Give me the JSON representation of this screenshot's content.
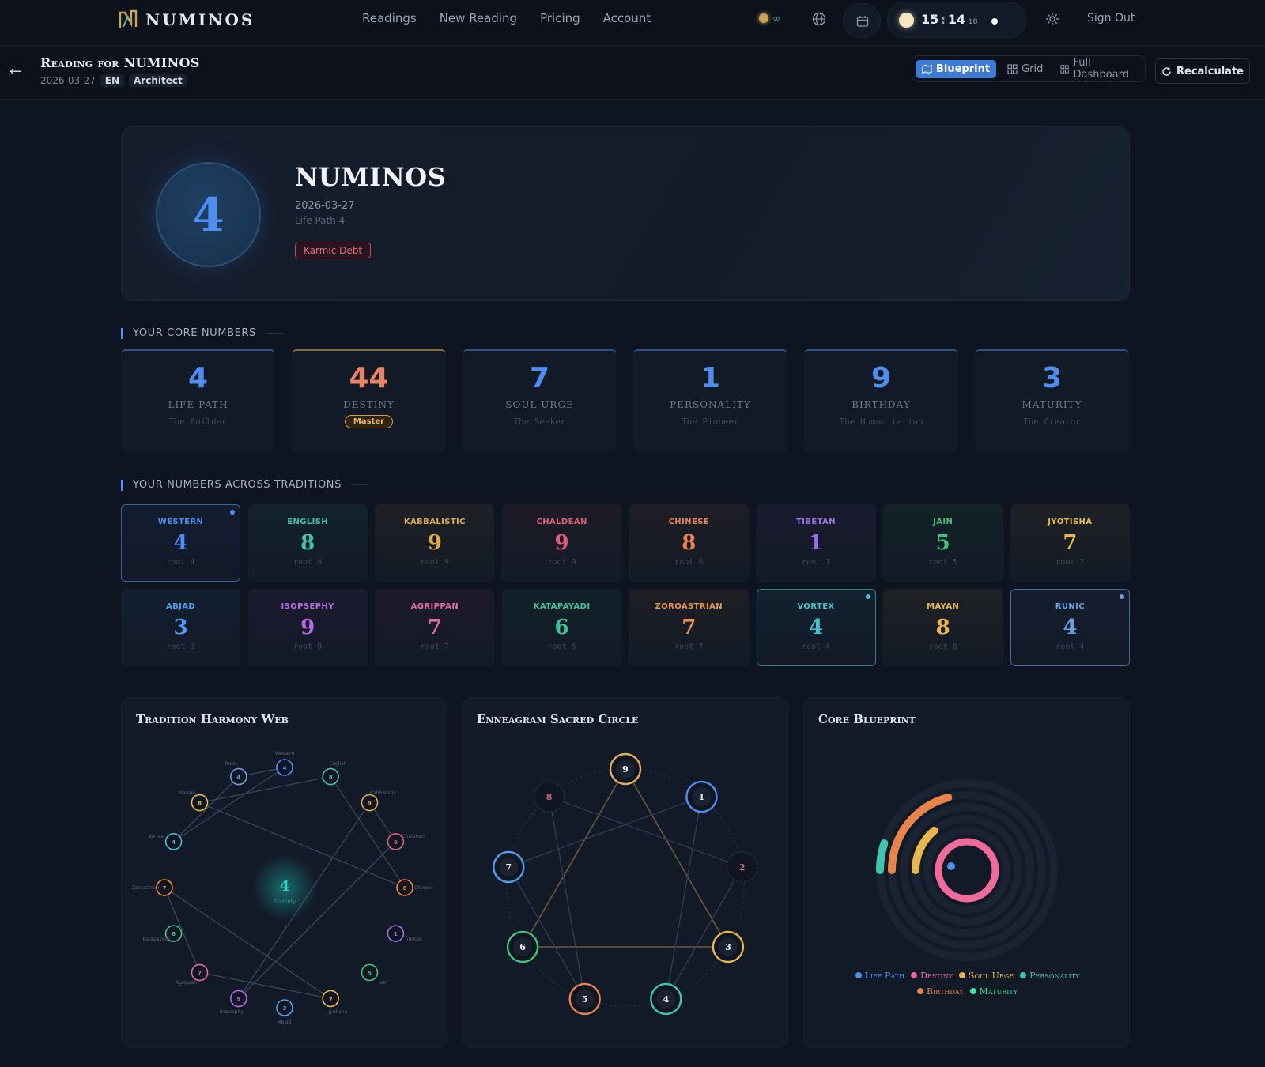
{
  "app": {
    "name": "NUMINOS"
  },
  "nav": {
    "items": [
      "Readings",
      "New Reading",
      "Pricing",
      "Account"
    ],
    "credits": "∞",
    "time_h": "15",
    "time_m": "14",
    "time_s": "18",
    "signout": "Sign Out"
  },
  "reading": {
    "title": "Reading for NUMINOS",
    "date": "2026-03-27",
    "lang": "EN",
    "mode": "Architect"
  },
  "views": {
    "items": [
      "Blueprint",
      "Grid",
      "Full Dashboard"
    ],
    "active": "Blueprint",
    "recalc": "Recalculate"
  },
  "hero": {
    "number": "4",
    "name": "NUMINOS",
    "date": "2026-03-27",
    "lifepath": "Life Path 4",
    "badge": "Karmic Debt"
  },
  "core": {
    "title": "YOUR CORE NUMBERS",
    "cards": [
      {
        "num": "4",
        "label": "LIFE PATH",
        "sub": "The Builder",
        "color": "#4d8ff0"
      },
      {
        "num": "44",
        "label": "DESTINY",
        "sub": "",
        "badge": "Master",
        "color": "#e8836a"
      },
      {
        "num": "7",
        "label": "SOUL URGE",
        "sub": "The Seeker",
        "color": "#4d8ff0"
      },
      {
        "num": "1",
        "label": "PERSONALITY",
        "sub": "The Pioneer",
        "color": "#4d8ff0"
      },
      {
        "num": "9",
        "label": "BIRTHDAY",
        "sub": "The Humanitarian",
        "color": "#4d8ff0"
      },
      {
        "num": "3",
        "label": "MATURITY",
        "sub": "The Creator",
        "color": "#4d8ff0"
      }
    ]
  },
  "traditions": {
    "title": "YOUR NUMBERS ACROSS TRADITIONS",
    "cards": [
      {
        "name": "WESTERN",
        "num": "4",
        "root": "root 4",
        "color": "#4d8ff0",
        "hl": true
      },
      {
        "name": "ENGLISH",
        "num": "8",
        "root": "root 8",
        "color": "#3fc4b0",
        "hl": false
      },
      {
        "name": "KABBALISTIC",
        "num": "9",
        "root": "root 9",
        "color": "#e0a94c",
        "hl": false
      },
      {
        "name": "CHALDEAN",
        "num": "9",
        "root": "root 9",
        "color": "#e25c7a",
        "hl": false
      },
      {
        "name": "CHINESE",
        "num": "8",
        "root": "root 8",
        "color": "#e8834a",
        "hl": false
      },
      {
        "name": "TIBETAN",
        "num": "1",
        "root": "root 1",
        "color": "#9b72e0",
        "hl": false
      },
      {
        "name": "JAIN",
        "num": "5",
        "root": "root 5",
        "color": "#3fc47a",
        "hl": false
      },
      {
        "name": "JYOTISHA",
        "num": "7",
        "root": "root 7",
        "color": "#e8b84a",
        "hl": false
      },
      {
        "name": "ABJAD",
        "num": "3",
        "root": "root 3",
        "color": "#4d9ff0",
        "hl": false
      },
      {
        "name": "ISOPSEPHY",
        "num": "9",
        "root": "root 9",
        "color": "#b46ae0",
        "hl": false
      },
      {
        "name": "AGRIPPAN",
        "num": "7",
        "root": "root 7",
        "color": "#e06aa8",
        "hl": false
      },
      {
        "name": "KATAPAYADI",
        "num": "6",
        "root": "root 6",
        "color": "#3fc49a",
        "hl": false
      },
      {
        "name": "ZOROASTRIAN",
        "num": "7",
        "root": "root 7",
        "color": "#e8944a",
        "hl": false
      },
      {
        "name": "VORTEX",
        "num": "4",
        "root": "root 4",
        "color": "#3fc4d0",
        "hl": true
      },
      {
        "name": "MAYAN",
        "num": "8",
        "root": "root 8",
        "color": "#e8b84a",
        "hl": false
      },
      {
        "name": "RUNIC",
        "num": "4",
        "root": "root 4",
        "color": "#6a9fe0",
        "hl": true
      }
    ]
  },
  "harmony": {
    "title": "Tradition Harmony Web",
    "center": "4",
    "center_label": "Stability",
    "nodes": [
      {
        "label": "Western",
        "num": "4",
        "color": "#4d8ff0"
      },
      {
        "label": "English",
        "num": "8",
        "color": "#3fc4b0"
      },
      {
        "label": "Kabbalistic",
        "num": "9",
        "color": "#e0a94c"
      },
      {
        "label": "Chaldean",
        "num": "9",
        "color": "#e25c7a"
      },
      {
        "label": "Chinese",
        "num": "8",
        "color": "#e8834a"
      },
      {
        "label": "Tibetan",
        "num": "1",
        "color": "#9b72e0"
      },
      {
        "label": "Jain",
        "num": "5",
        "color": "#3fc47a"
      },
      {
        "label": "Jyotisha",
        "num": "7",
        "color": "#e8b84a"
      },
      {
        "label": "Abjad",
        "num": "3",
        "color": "#4d9ff0"
      },
      {
        "label": "Isopsephy",
        "num": "9",
        "color": "#b46ae0"
      },
      {
        "label": "Agrippan",
        "num": "7",
        "color": "#e06aa8"
      },
      {
        "label": "Katapayadi",
        "num": "6",
        "color": "#3fc49a"
      },
      {
        "label": "Zoroastrian",
        "num": "7",
        "color": "#e8944a"
      },
      {
        "label": "Vortex",
        "num": "4",
        "color": "#3fc4d0"
      },
      {
        "label": "Mayan",
        "num": "8",
        "color": "#e8b84a"
      },
      {
        "label": "Runic",
        "num": "4",
        "color": "#6a9fe0"
      }
    ]
  },
  "enneagram": {
    "title": "Enneagram Sacred Circle",
    "nodes": [
      {
        "num": "9",
        "color": "#e0b05c",
        "active": true
      },
      {
        "num": "1",
        "color": "#4d8ff0",
        "active": true
      },
      {
        "num": "2",
        "color": "#e25c7a",
        "active": false
      },
      {
        "num": "3",
        "color": "#e8b84a",
        "active": true
      },
      {
        "num": "4",
        "color": "#3fc4b0",
        "active": true
      },
      {
        "num": "5",
        "color": "#e8834a",
        "active": true
      },
      {
        "num": "6",
        "color": "#3fc47a",
        "active": true
      },
      {
        "num": "7",
        "color": "#4d9ff0",
        "active": true
      },
      {
        "num": "8",
        "color": "#e25c7a",
        "active": false
      }
    ]
  },
  "blueprint": {
    "title": "Core Blueprint",
    "legend": [
      {
        "label": "Life Path",
        "color": "#4d8ff0"
      },
      {
        "label": "Destiny",
        "color": "#f06a9a"
      },
      {
        "label": "Soul Urge",
        "color": "#e8b84a"
      },
      {
        "label": "Personality",
        "color": "#3fc4b0"
      },
      {
        "label": "Birthday",
        "color": "#e8834a"
      },
      {
        "label": "Maturity",
        "color": "#3fe0a0"
      }
    ]
  }
}
